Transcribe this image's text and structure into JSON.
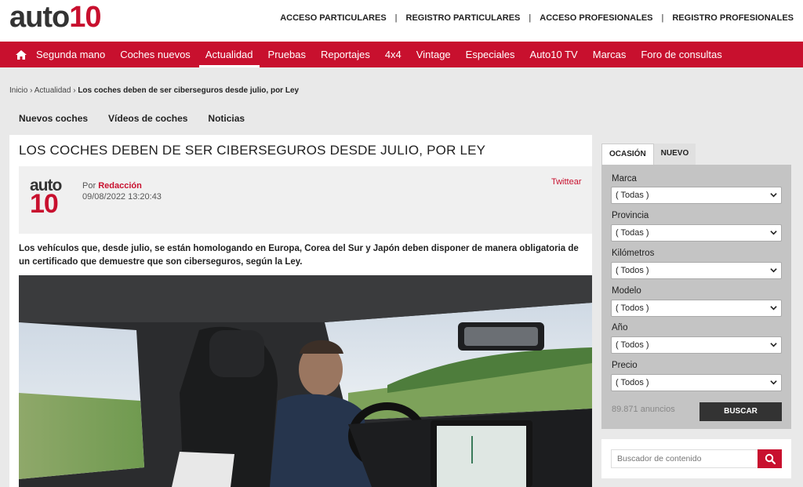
{
  "brand": {
    "logo_part1": "auto",
    "logo_part2": "10",
    "accent": "#c8102e"
  },
  "top_links": [
    "ACCESO PARTICULARES",
    "REGISTRO PARTICULARES",
    "ACCESO PROFESIONALES",
    "REGISTRO PROFESIONALES"
  ],
  "top_sep": "|",
  "nav": {
    "home_icon": "home-icon",
    "items": [
      "Segunda mano",
      "Coches nuevos",
      "Actualidad",
      "Pruebas",
      "Reportajes",
      "4x4",
      "Vintage",
      "Especiales",
      "Auto10 TV",
      "Marcas",
      "Foro de consultas"
    ],
    "active": "Actualidad"
  },
  "breadcrumb": {
    "home": "Inicio",
    "sep": "›",
    "section": "Actualidad",
    "current": "Los coches deben de ser ciberseguros desde julio, por Ley"
  },
  "subtabs": [
    "Nuevos coches",
    "Vídeos de coches",
    "Noticias"
  ],
  "article": {
    "headline": "LOS COCHES DEBEN DE SER CIBERSEGUROS DESDE JULIO, POR LEY",
    "by_prefix": "Por",
    "author": "Redacción",
    "date": "09/08/2022 13:20:43",
    "tweet": "Twittear",
    "lead": "Los vehículos que, desde julio, se están homologando en Europa, Corea del Sur y Japón deben disponer de manera obligatoria de un certificado que demuestre que son ciberseguros, según la Ley."
  },
  "sidebar": {
    "tabs": [
      "OCASIÓN",
      "NUEVO"
    ],
    "active_tab": "OCASIÓN",
    "fields": [
      {
        "label": "Marca",
        "value": "( Todas )"
      },
      {
        "label": "Provincia",
        "value": "( Todas )"
      },
      {
        "label": "Kilómetros",
        "value": "( Todos )"
      },
      {
        "label": "Modelo",
        "value": "( Todos )"
      },
      {
        "label": "Año",
        "value": "( Todos )"
      },
      {
        "label": "Precio",
        "value": "( Todos )"
      }
    ],
    "count": "89.871 anuncios",
    "search_button": "BUSCAR",
    "content_search_placeholder": "Buscador de contenido",
    "content_search_icon": "search-icon"
  }
}
